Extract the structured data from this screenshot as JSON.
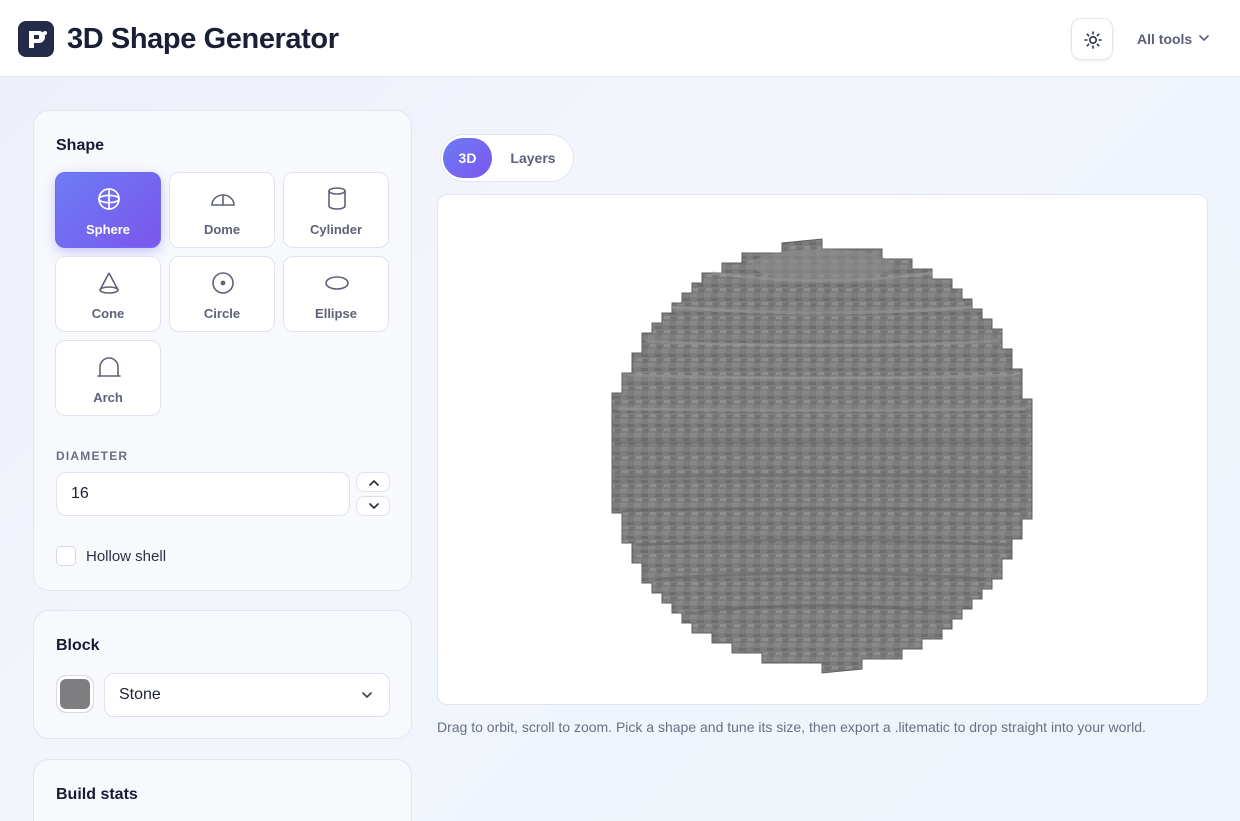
{
  "app": {
    "title": "3D Shape Generator",
    "logo_icon": "p-logo-icon",
    "theme_icon": "sun-icon",
    "all_tools_label": "All tools"
  },
  "colors": {
    "accent_start": "#6c7cf4",
    "accent_end": "#7b56ec",
    "block_swatch": "#7e7e80"
  },
  "shape_panel": {
    "title": "Shape",
    "shapes": [
      {
        "label": "Sphere",
        "icon": "sphere-icon",
        "selected": true
      },
      {
        "label": "Dome",
        "icon": "dome-icon",
        "selected": false
      },
      {
        "label": "Cylinder",
        "icon": "cylinder-icon",
        "selected": false
      },
      {
        "label": "Cone",
        "icon": "cone-icon",
        "selected": false
      },
      {
        "label": "Circle",
        "icon": "circle-icon",
        "selected": false
      },
      {
        "label": "Ellipse",
        "icon": "ellipse-icon",
        "selected": false
      },
      {
        "label": "Arch",
        "icon": "arch-icon",
        "selected": false
      }
    ],
    "diameter_label": "DIAMETER",
    "diameter_value": "16",
    "hollow_label": "Hollow shell",
    "hollow_checked": false
  },
  "block_panel": {
    "title": "Block",
    "selected_block": "Stone"
  },
  "stats_panel": {
    "title": "Build stats"
  },
  "viewer": {
    "tabs": [
      "3D",
      "Layers"
    ],
    "active_tab": "3D",
    "hint": "Drag to orbit, scroll to zoom. Pick a shape and tune its size, then export a .litematic to drop straight into your world."
  }
}
